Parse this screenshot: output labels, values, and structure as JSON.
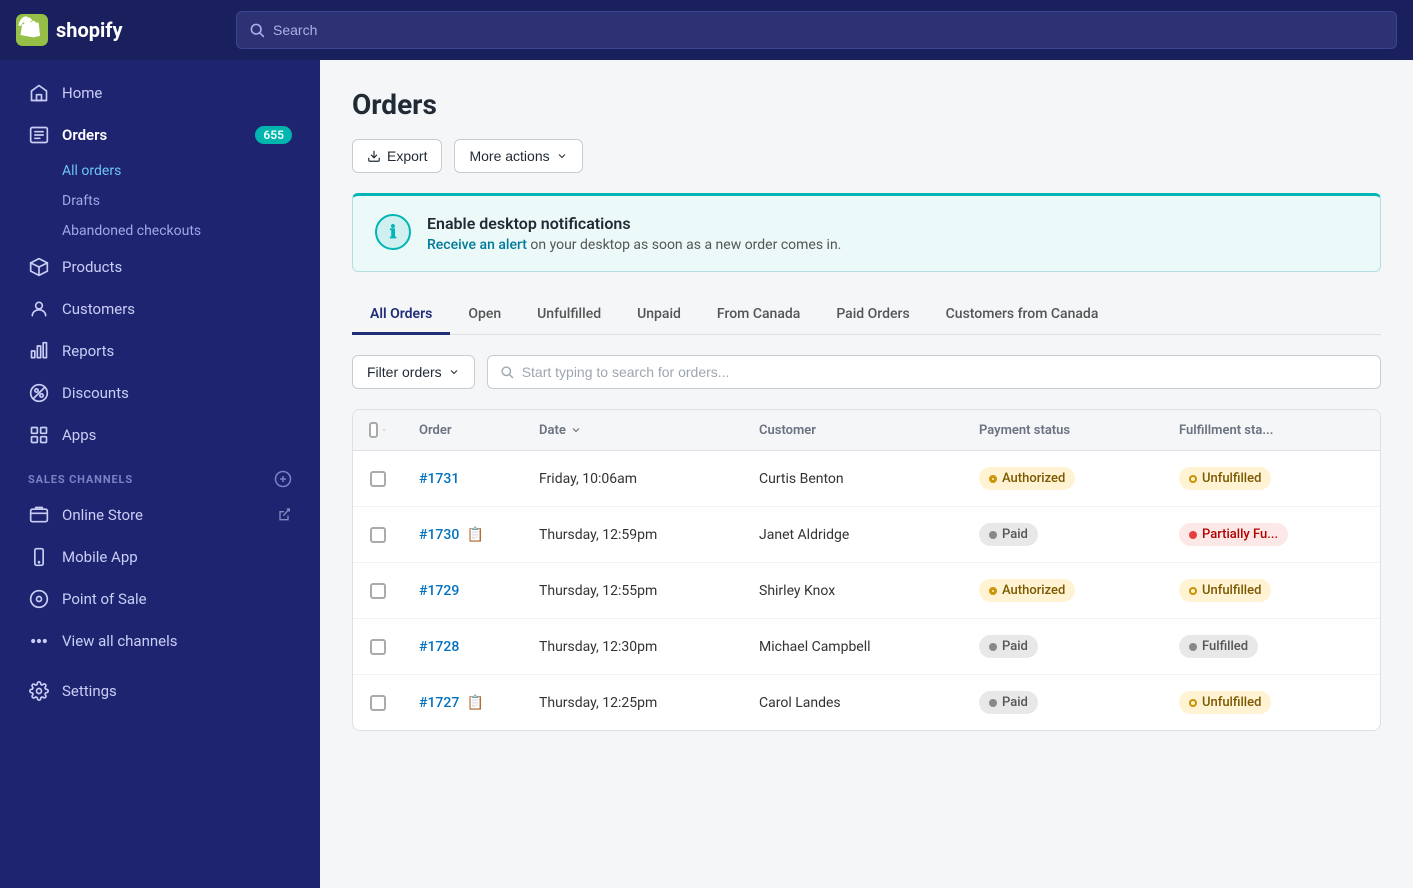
{
  "header": {
    "logo_text": "shopify",
    "search_placeholder": "Search"
  },
  "sidebar": {
    "main_items": [
      {
        "id": "home",
        "label": "Home",
        "icon": "home-icon"
      },
      {
        "id": "orders",
        "label": "Orders",
        "icon": "orders-icon",
        "badge": "655",
        "active": true
      },
      {
        "id": "products",
        "label": "Products",
        "icon": "products-icon"
      },
      {
        "id": "customers",
        "label": "Customers",
        "icon": "customers-icon"
      },
      {
        "id": "reports",
        "label": "Reports",
        "icon": "reports-icon"
      },
      {
        "id": "discounts",
        "label": "Discounts",
        "icon": "discounts-icon"
      },
      {
        "id": "apps",
        "label": "Apps",
        "icon": "apps-icon"
      }
    ],
    "orders_sub_items": [
      {
        "id": "all-orders",
        "label": "All orders",
        "active": true
      },
      {
        "id": "drafts",
        "label": "Drafts"
      },
      {
        "id": "abandoned-checkouts",
        "label": "Abandoned checkouts"
      }
    ],
    "sales_channels_label": "SALES CHANNELS",
    "sales_channels": [
      {
        "id": "online-store",
        "label": "Online Store",
        "has_ext": true
      },
      {
        "id": "mobile-app",
        "label": "Mobile App"
      },
      {
        "id": "point-of-sale",
        "label": "Point of Sale"
      }
    ],
    "view_all_channels_label": "View all channels",
    "settings_label": "Settings"
  },
  "page": {
    "title": "Orders",
    "export_label": "Export",
    "more_actions_label": "More actions"
  },
  "notification": {
    "title": "Enable desktop notifications",
    "link_text": "Receive an alert",
    "body_text": " on your desktop as soon as a new order comes in."
  },
  "tabs": [
    {
      "id": "all-orders",
      "label": "All Orders",
      "active": true
    },
    {
      "id": "open",
      "label": "Open"
    },
    {
      "id": "unfulfilled",
      "label": "Unfulfilled"
    },
    {
      "id": "unpaid",
      "label": "Unpaid"
    },
    {
      "id": "from-canada",
      "label": "From Canada"
    },
    {
      "id": "paid-orders",
      "label": "Paid Orders"
    },
    {
      "id": "customers-from-canada",
      "label": "Customers from Canada"
    }
  ],
  "filter": {
    "filter_label": "Filter orders",
    "search_placeholder": "Start typing to search for orders..."
  },
  "table": {
    "columns": [
      "",
      "Order",
      "Date",
      "Customer",
      "Payment status",
      "Fulfillment sta..."
    ],
    "rows": [
      {
        "id": "row-1731",
        "order": "#1731",
        "has_note": false,
        "date": "Friday, 10:06am",
        "customer": "Curtis Benton",
        "payment_status": "Authorized",
        "payment_badge": "authorized",
        "fulfillment_status": "Unfulfilled",
        "fulfillment_badge": "unfulfilled"
      },
      {
        "id": "row-1730",
        "order": "#1730",
        "has_note": true,
        "date": "Thursday, 12:59pm",
        "customer": "Janet Aldridge",
        "payment_status": "Paid",
        "payment_badge": "paid",
        "fulfillment_status": "Partially Fu...",
        "fulfillment_badge": "partially"
      },
      {
        "id": "row-1729",
        "order": "#1729",
        "has_note": false,
        "date": "Thursday, 12:55pm",
        "customer": "Shirley Knox",
        "payment_status": "Authorized",
        "payment_badge": "authorized",
        "fulfillment_status": "Unfulfilled",
        "fulfillment_badge": "unfulfilled"
      },
      {
        "id": "row-1728",
        "order": "#1728",
        "has_note": false,
        "date": "Thursday, 12:30pm",
        "customer": "Michael Campbell",
        "payment_status": "Paid",
        "payment_badge": "paid",
        "fulfillment_status": "Fulfilled",
        "fulfillment_badge": "fulfilled"
      },
      {
        "id": "row-1727",
        "order": "#1727",
        "has_note": true,
        "date": "Thursday, 12:25pm",
        "customer": "Carol Landes",
        "payment_status": "Paid",
        "payment_badge": "paid",
        "fulfillment_status": "Unfulfilled",
        "fulfillment_badge": "unfulfilled"
      }
    ]
  }
}
